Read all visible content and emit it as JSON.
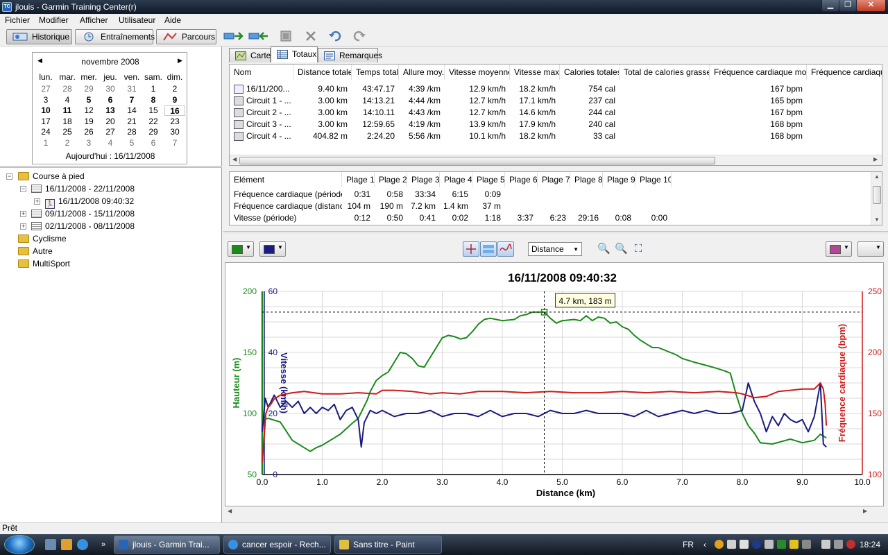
{
  "window": {
    "title": "jlouis - Garmin Training Center(r)",
    "app_icon": "TC",
    "min": "▁",
    "max": "❐",
    "close": "✕"
  },
  "menu": [
    "Fichier",
    "Modifier",
    "Afficher",
    "Utilisateur",
    "Aide"
  ],
  "toolbar": {
    "historique": "Historique",
    "entrainements": "Entraînements",
    "parcours": "Parcours"
  },
  "calendar": {
    "month": "novembre 2008",
    "weekdays": [
      "lun.",
      "mar.",
      "mer.",
      "jeu.",
      "ven.",
      "sam.",
      "dim."
    ],
    "weeks": [
      [
        "27",
        "28",
        "29",
        "30",
        "31",
        "1",
        "2"
      ],
      [
        "3",
        "4",
        "5",
        "6",
        "7",
        "8",
        "9"
      ],
      [
        "10",
        "11",
        "12",
        "13",
        "14",
        "15",
        "16"
      ],
      [
        "17",
        "18",
        "19",
        "20",
        "21",
        "22",
        "23"
      ],
      [
        "24",
        "25",
        "26",
        "27",
        "28",
        "29",
        "30"
      ],
      [
        "1",
        "2",
        "3",
        "4",
        "5",
        "6",
        "7"
      ]
    ],
    "today_label": "Aujourd'hui : 16/11/2008"
  },
  "tree": {
    "course": "Course à pied",
    "week1": "16/11/2008 - 22/11/2008",
    "activity": "16/11/2008 09:40:32",
    "week2": "09/11/2008 - 15/11/2008",
    "week3": "02/11/2008 - 08/11/2008",
    "cyclisme": "Cyclisme",
    "autre": "Autre",
    "multisport": "MultiSport"
  },
  "tabs": {
    "carte": "Carte",
    "totaux": "Totaux",
    "remarques": "Remarques"
  },
  "totals": {
    "headers": [
      "Nom",
      "Distance totale",
      "Temps total",
      "Allure moy.",
      "Vitesse moyenne",
      "Vitesse max.",
      "Calories totales",
      "Total de calories grasses",
      "Fréquence cardiaque moy.",
      "Fréquence cardiaque"
    ],
    "rows": [
      [
        "16/11/200...",
        "9.40 km",
        "43:47.17",
        "4:39 /km",
        "12.9 km/h",
        "18.2 km/h",
        "754 cal",
        "",
        "167 bpm"
      ],
      [
        "Circuit 1 - ...",
        "3.00 km",
        "14:13.21",
        "4:44 /km",
        "12.7 km/h",
        "17.1 km/h",
        "237 cal",
        "",
        "165 bpm"
      ],
      [
        "Circuit 2 - ...",
        "3.00 km",
        "14:10.11",
        "4:43 /km",
        "12.7 km/h",
        "14.6 km/h",
        "244 cal",
        "",
        "167 bpm"
      ],
      [
        "Circuit 3 - ...",
        "3.00 km",
        "12:59.65",
        "4:19 /km",
        "13.9 km/h",
        "17.9 km/h",
        "240 cal",
        "",
        "168 bpm"
      ],
      [
        "Circuit 4 - ...",
        "404.82 m",
        "2:24.20",
        "5:56 /km",
        "10.1 km/h",
        "18.2 km/h",
        "33 cal",
        "",
        "168 bpm"
      ]
    ]
  },
  "zones": {
    "headers": [
      "Elément",
      "Plage 1",
      "Plage 2",
      "Plage 3",
      "Plage 4",
      "Plage 5",
      "Plage 6",
      "Plage 7",
      "Plage 8",
      "Plage 9",
      "Plage 10"
    ],
    "rows": [
      [
        "Fréquence cardiaque (période)",
        "0:31",
        "0:58",
        "33:34",
        "6:15",
        "0:09",
        "",
        "",
        "",
        "",
        ""
      ],
      [
        "Fréquence cardiaque (distance)",
        "104 m",
        "190 m",
        "7.2 km",
        "1.4 km",
        "37 m",
        "",
        "",
        "",
        "",
        ""
      ],
      [
        "Vitesse (période)",
        "0:12",
        "0:50",
        "0:41",
        "0:02",
        "1:18",
        "3:37",
        "6:23",
        "29:16",
        "0:08",
        "0:00"
      ]
    ]
  },
  "chart_tools": {
    "axis_select": "Distance"
  },
  "colors": {
    "elevation": "#1a8a1a",
    "speed": "#1a1a80",
    "heart_rate": "#d01818",
    "extra": "#b04a90"
  },
  "chart_data": {
    "type": "line",
    "title": "16/11/2008 09:40:32",
    "xlabel": "Distance (km)",
    "xlim": [
      0,
      10
    ],
    "xticks": [
      "0.0",
      "1.0",
      "2.0",
      "3.0",
      "4.0",
      "5.0",
      "6.0",
      "7.0",
      "8.0",
      "9.0",
      "10.0"
    ],
    "y_axes": {
      "elevation": {
        "label": "Hauteur (m)",
        "lim": [
          50,
          200
        ],
        "ticks": [
          "50",
          "100",
          "150",
          "200"
        ]
      },
      "speed": {
        "label": "Vitesse (km/h)",
        "lim": [
          0,
          60
        ],
        "ticks": [
          "0",
          "20",
          "40",
          "60"
        ]
      },
      "heart_rate": {
        "label": "Fréquence cardiaque (bpm)",
        "lim": [
          100,
          250
        ],
        "ticks": [
          "100",
          "150",
          "200",
          "250"
        ]
      }
    },
    "cursor": {
      "x": 4.7,
      "y": 183,
      "label": "4.7 km, 183 m"
    },
    "grid": true,
    "series": [
      {
        "axis": "elevation",
        "x": [
          0.0,
          0.1,
          0.3,
          0.5,
          0.7,
          0.8,
          0.9,
          1.0,
          1.2,
          1.3,
          1.5,
          1.6,
          1.75,
          1.8,
          1.9,
          2.0,
          2.1,
          2.2,
          2.3,
          2.4,
          2.5,
          2.6,
          2.7,
          2.8,
          2.9,
          3.0,
          3.1,
          3.2,
          3.3,
          3.4,
          3.5,
          3.6,
          3.7,
          3.8,
          3.9,
          4.0,
          4.2,
          4.3,
          4.4,
          4.5,
          4.6,
          4.7,
          4.8,
          4.9,
          5.0,
          5.2,
          5.3,
          5.4,
          5.5,
          5.6,
          5.7,
          5.8,
          5.9,
          6.0,
          6.1,
          6.2,
          6.3,
          6.4,
          6.5,
          6.6,
          6.7,
          6.8,
          6.9,
          7.0,
          7.2,
          7.5,
          7.7,
          7.8,
          7.9,
          8.0,
          8.1,
          8.2,
          8.3,
          8.5,
          8.8,
          9.0,
          9.2,
          9.3,
          9.4
        ],
        "values": [
          95,
          96,
          93,
          78,
          72,
          69,
          72,
          74,
          80,
          83,
          92,
          96,
          111,
          118,
          127,
          131,
          134,
          142,
          150,
          149,
          145,
          139,
          138,
          146,
          154,
          162,
          164,
          163,
          161,
          162,
          167,
          173,
          177,
          178,
          177,
          176,
          177,
          180,
          181,
          183,
          183,
          183,
          178,
          174,
          176,
          177,
          176,
          180,
          176,
          179,
          178,
          174,
          175,
          171,
          169,
          164,
          160,
          157,
          154,
          154,
          152,
          150,
          148,
          145,
          142,
          138,
          135,
          133,
          115,
          100,
          90,
          84,
          76,
          75,
          79,
          76,
          78,
          83,
          80
        ]
      },
      {
        "axis": "speed",
        "x": [
          0.0,
          0.05,
          0.1,
          0.2,
          0.3,
          0.4,
          0.5,
          0.6,
          0.7,
          0.8,
          0.9,
          1.0,
          1.1,
          1.2,
          1.3,
          1.4,
          1.5,
          1.6,
          1.65,
          1.7,
          1.8,
          1.9,
          2.0,
          2.2,
          2.4,
          2.6,
          2.8,
          3.0,
          3.2,
          3.4,
          3.6,
          3.8,
          4.0,
          4.2,
          4.4,
          4.6,
          4.8,
          5.0,
          5.2,
          5.4,
          5.6,
          5.8,
          6.0,
          6.2,
          6.4,
          6.6,
          6.8,
          7.0,
          7.2,
          7.4,
          7.6,
          7.8,
          8.0,
          8.1,
          8.2,
          8.3,
          8.4,
          8.5,
          8.6,
          8.7,
          8.8,
          8.9,
          9.0,
          9.1,
          9.2,
          9.3,
          9.35,
          9.4
        ],
        "values": [
          14,
          25,
          22,
          26,
          22,
          24,
          22,
          24,
          20,
          22,
          20,
          22,
          21,
          23,
          18,
          21,
          22,
          18,
          9,
          17,
          21,
          20,
          21,
          19,
          20,
          20,
          21,
          19,
          20,
          20,
          19,
          21,
          19,
          20,
          20,
          19,
          21,
          20,
          20,
          21,
          20,
          20,
          20,
          19,
          21,
          19,
          20,
          21,
          20,
          21,
          20,
          20,
          21,
          30,
          24,
          20,
          14,
          19,
          16,
          20,
          18,
          17,
          18,
          14,
          19,
          30,
          10,
          9
        ]
      },
      {
        "axis": "heart_rate",
        "x": [
          0.0,
          0.03,
          0.06,
          0.1,
          0.15,
          0.2,
          0.3,
          0.5,
          0.7,
          1.0,
          1.3,
          1.6,
          1.9,
          2.0,
          2.2,
          2.5,
          2.8,
          3.0,
          3.3,
          3.6,
          4.0,
          4.4,
          4.8,
          5.2,
          5.6,
          6.0,
          6.4,
          6.8,
          7.2,
          7.6,
          7.9,
          8.0,
          8.2,
          8.4,
          8.6,
          8.8,
          9.0,
          9.2,
          9.3,
          9.35,
          9.38,
          9.4
        ],
        "values": [
          110,
          130,
          150,
          155,
          158,
          162,
          165,
          167,
          168,
          166,
          166,
          167,
          166,
          169,
          169,
          168,
          166,
          167,
          166,
          168,
          168,
          167,
          168,
          167,
          167,
          168,
          167,
          168,
          167,
          168,
          167,
          166,
          163,
          164,
          168,
          169,
          170,
          170,
          175,
          170,
          158,
          140
        ]
      }
    ]
  }
}
